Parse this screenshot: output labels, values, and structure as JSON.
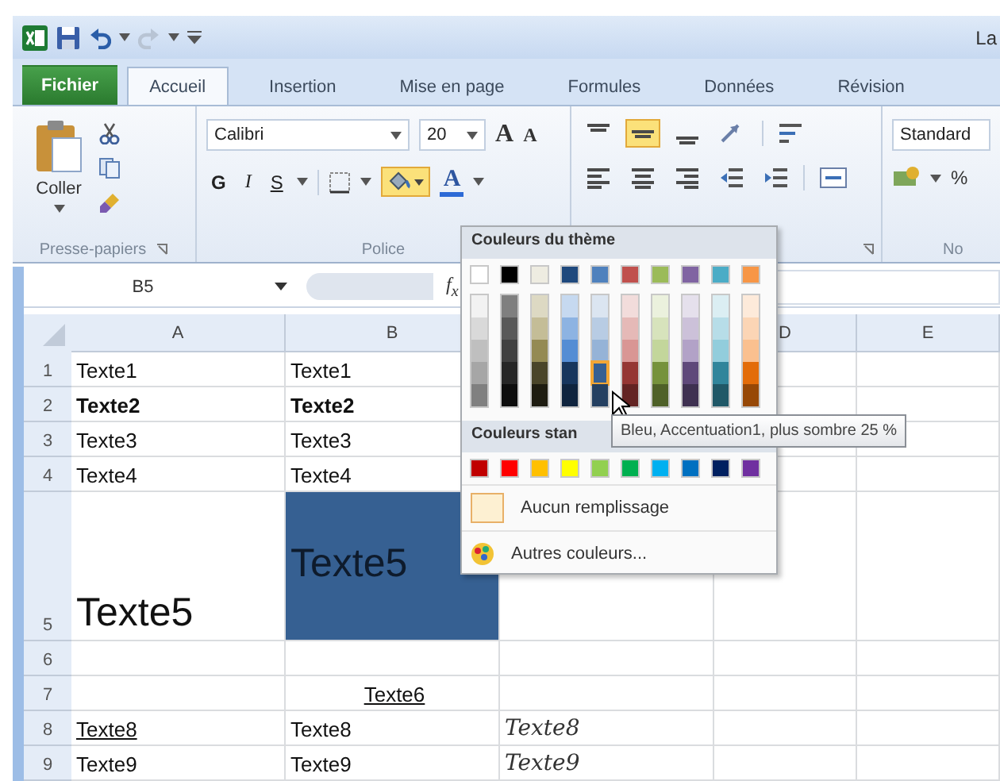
{
  "window": {
    "title": "La"
  },
  "tabs": [
    {
      "label": "Fichier",
      "kind": "file",
      "selected": false
    },
    {
      "label": "Accueil",
      "kind": "tab",
      "selected": true
    },
    {
      "label": "Insertion",
      "kind": "tab",
      "selected": false
    },
    {
      "label": "Mise en page",
      "kind": "tab",
      "selected": false
    },
    {
      "label": "Formules",
      "kind": "tab",
      "selected": false
    },
    {
      "label": "Données",
      "kind": "tab",
      "selected": false
    },
    {
      "label": "Révision",
      "kind": "tab",
      "selected": false
    }
  ],
  "ribbon": {
    "groups": [
      {
        "kind": "clipboard",
        "label": "Presse-papiers",
        "paste_label": "Coller"
      },
      {
        "kind": "font",
        "label": "Police",
        "font_name": "Calibri",
        "font_size": "20",
        "grow_label": "A",
        "shrink_label": "A",
        "style_buttons": [
          {
            "label": "G",
            "kind": "bold"
          },
          {
            "label": "I",
            "kind": "italic"
          },
          {
            "label": "S",
            "kind": "underline"
          }
        ],
        "fill_pressed": true,
        "font_color_label": "A"
      },
      {
        "kind": "alignment",
        "middle_pressed": true
      },
      {
        "kind": "number",
        "label": "No",
        "format": "Standard",
        "percent": "%"
      }
    ]
  },
  "formula_bar": {
    "name_box": "B5",
    "function_label": "f$_{x}$"
  },
  "sheet": {
    "columns": [
      {
        "label": "A"
      },
      {
        "label": "B"
      },
      {},
      {
        "label": "D"
      },
      {
        "label": "E"
      }
    ],
    "rows": [
      {
        "number": "1",
        "cells": [
          {
            "text": "Texte1",
            "kind": "plain"
          },
          {
            "text": "Texte1",
            "kind": "plain"
          }
        ]
      },
      {
        "number": "2",
        "cells": [
          {
            "text": "Texte2",
            "kind": "bold"
          },
          {
            "text": "Texte2",
            "kind": "bold"
          }
        ]
      },
      {
        "number": "3",
        "cells": [
          {
            "text": "Texte3",
            "kind": "plain"
          },
          {
            "text": "Texte3",
            "kind": "plain"
          }
        ]
      },
      {
        "number": "4",
        "cells": [
          {
            "text": "Texte4",
            "kind": "plain"
          },
          {
            "text": "Texte4",
            "kind": "plain"
          }
        ]
      },
      {
        "number": "5",
        "cells": [
          {
            "text": "Texte5",
            "kind": "large"
          },
          {
            "text": "Texte5",
            "kind": "large",
            "color": "#366092",
            "vertically_centered": true
          }
        ]
      },
      {
        "number": "6"
      },
      {
        "number": "7",
        "cells": [
          null,
          {
            "text": "Texte6",
            "kind": "underline",
            "centered": true
          }
        ]
      },
      {
        "number": "8",
        "cells": [
          {
            "text": "Texte8",
            "kind": "underline"
          },
          {
            "text": "Texte8",
            "kind": "plain"
          },
          {
            "text": "Texte8",
            "kind": "script"
          }
        ]
      },
      {
        "number": "9",
        "cells": [
          {
            "text": "Texte9",
            "kind": "plain"
          },
          {
            "text": "Texte9",
            "kind": "plain"
          },
          {
            "text": "Texte9",
            "kind": "script"
          }
        ]
      }
    ]
  },
  "color_menu": {
    "theme_title": "Couleurs du thème",
    "theme": [
      {
        "color": "#ffffff",
        "shades": [
          {
            "color": "#f2f2f2",
            "selected": false
          },
          {
            "color": "#d9d9d9",
            "selected": false
          },
          {
            "color": "#bfbfbf",
            "selected": false
          },
          {
            "color": "#a6a6a6",
            "selected": false
          },
          {
            "color": "#808080",
            "selected": false
          }
        ]
      },
      {
        "color": "#000000",
        "shades": [
          {
            "color": "#7f7f7f",
            "selected": false
          },
          {
            "color": "#595959",
            "selected": false
          },
          {
            "color": "#404040",
            "selected": false
          },
          {
            "color": "#262626",
            "selected": false
          },
          {
            "color": "#0d0d0d",
            "selected": false
          }
        ]
      },
      {
        "color": "#eeece1",
        "shades": [
          {
            "color": "#ddd9c3",
            "selected": false
          },
          {
            "color": "#c4bd97",
            "selected": false
          },
          {
            "color": "#948a54",
            "selected": false
          },
          {
            "color": "#4a452a",
            "selected": false
          },
          {
            "color": "#1e1c11",
            "selected": false
          }
        ]
      },
      {
        "color": "#1f497d",
        "shades": [
          {
            "color": "#c6d9f0",
            "selected": false
          },
          {
            "color": "#8db3e2",
            "selected": false
          },
          {
            "color": "#548dd4",
            "selected": false
          },
          {
            "color": "#17365d",
            "selected": false
          },
          {
            "color": "#0f243e",
            "selected": false
          }
        ]
      },
      {
        "color": "#4f81bd",
        "shades": [
          {
            "color": "#dbe5f1",
            "selected": false
          },
          {
            "color": "#b8cce4",
            "selected": false
          },
          {
            "color": "#95b3d7",
            "selected": false
          },
          {
            "color": "#366092",
            "selected": true
          },
          {
            "color": "#244061",
            "selected": false
          }
        ]
      },
      {
        "color": "#c0504d",
        "shades": [
          {
            "color": "#f2dcdb",
            "selected": false
          },
          {
            "color": "#e5b9b7",
            "selected": false
          },
          {
            "color": "#d99694",
            "selected": false
          },
          {
            "color": "#953734",
            "selected": false
          },
          {
            "color": "#632423",
            "selected": false
          }
        ]
      },
      {
        "color": "#9bbb59",
        "shades": [
          {
            "color": "#ebf1dd",
            "selected": false
          },
          {
            "color": "#d7e3bc",
            "selected": false
          },
          {
            "color": "#c3d69b",
            "selected": false
          },
          {
            "color": "#76923c",
            "selected": false
          },
          {
            "color": "#4f6128",
            "selected": false
          }
        ]
      },
      {
        "color": "#8064a2",
        "shades": [
          {
            "color": "#e5e0ec",
            "selected": false
          },
          {
            "color": "#ccc1d9",
            "selected": false
          },
          {
            "color": "#b2a2c7",
            "selected": false
          },
          {
            "color": "#5f497a",
            "selected": false
          },
          {
            "color": "#3f3151",
            "selected": false
          }
        ]
      },
      {
        "color": "#4bacc6",
        "shades": [
          {
            "color": "#dbeef3",
            "selected": false
          },
          {
            "color": "#b7dde8",
            "selected": false
          },
          {
            "color": "#92cddc",
            "selected": false
          },
          {
            "color": "#31859b",
            "selected": false
          },
          {
            "color": "#205867",
            "selected": false
          }
        ]
      },
      {
        "color": "#f79646",
        "shades": [
          {
            "color": "#fdeada",
            "selected": false
          },
          {
            "color": "#fbd5b5",
            "selected": false
          },
          {
            "color": "#fac08f",
            "selected": false
          },
          {
            "color": "#e36c09",
            "selected": false
          },
          {
            "color": "#974806",
            "selected": false
          }
        ]
      }
    ],
    "standard_title": "Couleurs stan",
    "standard": [
      {
        "color": "#c00000"
      },
      {
        "color": "#ff0000"
      },
      {
        "color": "#ffc000"
      },
      {
        "color": "#ffff00"
      },
      {
        "color": "#92d050"
      },
      {
        "color": "#00b050"
      },
      {
        "color": "#00b0f0"
      },
      {
        "color": "#0070c0"
      },
      {
        "color": "#002060"
      },
      {
        "color": "#7030a0"
      }
    ],
    "items": [
      {
        "label": "Aucun remplissage",
        "kind": "no-fill"
      },
      {
        "label": "Autres couleurs...",
        "kind": "more"
      }
    ]
  },
  "tooltip": "Bleu, Accentuation1, plus sombre 25 %"
}
